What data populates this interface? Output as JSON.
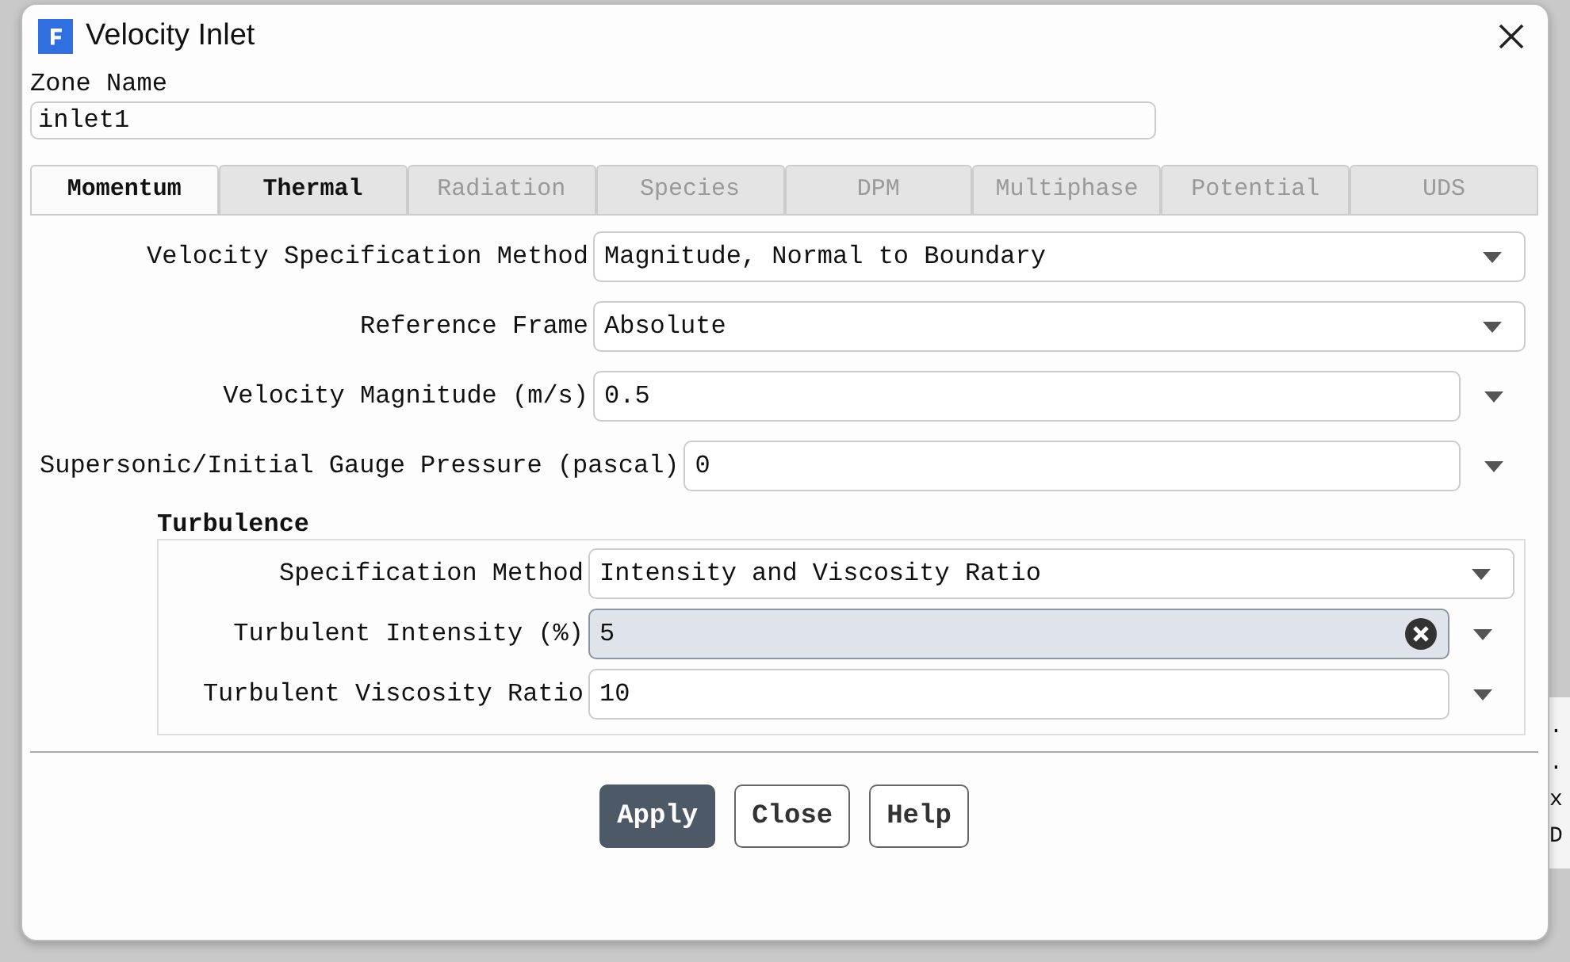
{
  "window": {
    "title": "Velocity Inlet"
  },
  "zone_name": {
    "label": "Zone Name",
    "value": "inlet1"
  },
  "tabs": [
    {
      "label": "Momentum",
      "selected": true,
      "disabled": false
    },
    {
      "label": "Thermal",
      "selected": false,
      "disabled": false
    },
    {
      "label": "Radiation",
      "selected": false,
      "disabled": true
    },
    {
      "label": "Species",
      "selected": false,
      "disabled": true
    },
    {
      "label": "DPM",
      "selected": false,
      "disabled": true
    },
    {
      "label": "Multiphase",
      "selected": false,
      "disabled": true
    },
    {
      "label": "Potential",
      "selected": false,
      "disabled": true
    },
    {
      "label": "UDS",
      "selected": false,
      "disabled": true
    }
  ],
  "fields": [
    {
      "kind": "dropdown",
      "label": "Velocity Specification Method",
      "value": "Magnitude, Normal to Boundary"
    },
    {
      "kind": "dropdown",
      "label": "Reference Frame",
      "value": "Absolute"
    },
    {
      "kind": "number",
      "label": "Velocity Magnitude (m/s)",
      "value": "0.5",
      "focused": false
    },
    {
      "kind": "number",
      "label": "Supersonic/Initial Gauge Pressure (pascal)",
      "value": "0",
      "focused": false
    }
  ],
  "turbulence": {
    "title": "Turbulence",
    "fields": [
      {
        "kind": "dropdown",
        "label": "Specification Method",
        "value": "Intensity and Viscosity Ratio"
      },
      {
        "kind": "number",
        "label": "Turbulent Intensity (%)",
        "value": "5",
        "focused": true
      },
      {
        "kind": "number",
        "label": "Turbulent Viscosity Ratio",
        "value": "10",
        "focused": false
      }
    ]
  },
  "buttons": [
    {
      "label": "Apply",
      "primary": true
    },
    {
      "label": "Close",
      "primary": false
    },
    {
      "label": "Help",
      "primary": false
    }
  ],
  "background": {
    "console_lines": [
      ".",
      ".",
      "x",
      "D"
    ]
  }
}
